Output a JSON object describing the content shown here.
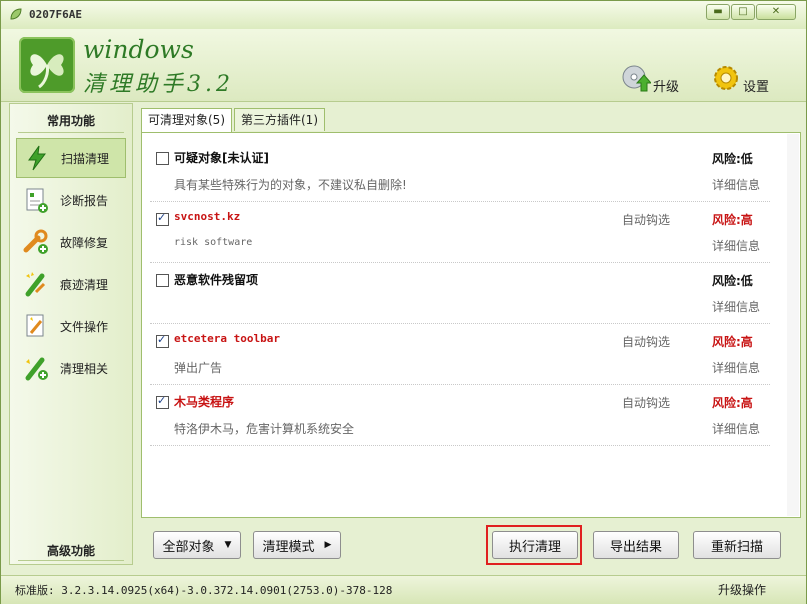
{
  "window": {
    "title": "0207F6AE"
  },
  "header": {
    "brand_line1": "windows",
    "brand_line2": "清理助手3.2",
    "upgrade_label": "升级",
    "settings_label": "设置"
  },
  "sidebar": {
    "common_heading": "常用功能",
    "advanced_heading": "高级功能",
    "items": [
      {
        "label": "扫描清理",
        "icon": "lightning-icon"
      },
      {
        "label": "诊断报告",
        "icon": "report-icon"
      },
      {
        "label": "故障修复",
        "icon": "wrench-icon"
      },
      {
        "label": "痕迹清理",
        "icon": "brush-icon"
      },
      {
        "label": "文件操作",
        "icon": "file-icon"
      },
      {
        "label": "清理相关",
        "icon": "clean-icon"
      }
    ]
  },
  "tabs": [
    {
      "label": "可清理对象(5)"
    },
    {
      "label": "第三方插件(1)"
    }
  ],
  "items": [
    {
      "name": "可疑对象[未认证]",
      "auto": "",
      "risk": "风险:低",
      "desc": "具有某些特殊行为的对象，不建议私自删除!",
      "details": "详细信息"
    },
    {
      "name": "svcnost.kz",
      "auto": "自动钩选",
      "risk": "风险:高",
      "desc": "risk software",
      "details": "详细信息"
    },
    {
      "name": "恶意软件残留项",
      "auto": "",
      "risk": "风险:低",
      "desc": "",
      "details": "详细信息"
    },
    {
      "name": "etcetera toolbar",
      "auto": "自动钩选",
      "risk": "风险:高",
      "desc": "弹出广告",
      "details": "详细信息"
    },
    {
      "name": "木马类程序",
      "auto": "自动钩选",
      "risk": "风险:高",
      "desc": "特洛伊木马，危害计算机系统安全",
      "details": "详细信息"
    }
  ],
  "buttons": {
    "all_objects": "全部对象",
    "clean_mode": "清理模式",
    "execute_clean": "执行清理",
    "export_results": "导出结果",
    "rescan": "重新扫描"
  },
  "status": {
    "version": "标准版: 3.2.3.14.0925(x64)-3.0.372.14.0901(2753.0)-378-128",
    "right_text": "升级操作"
  }
}
